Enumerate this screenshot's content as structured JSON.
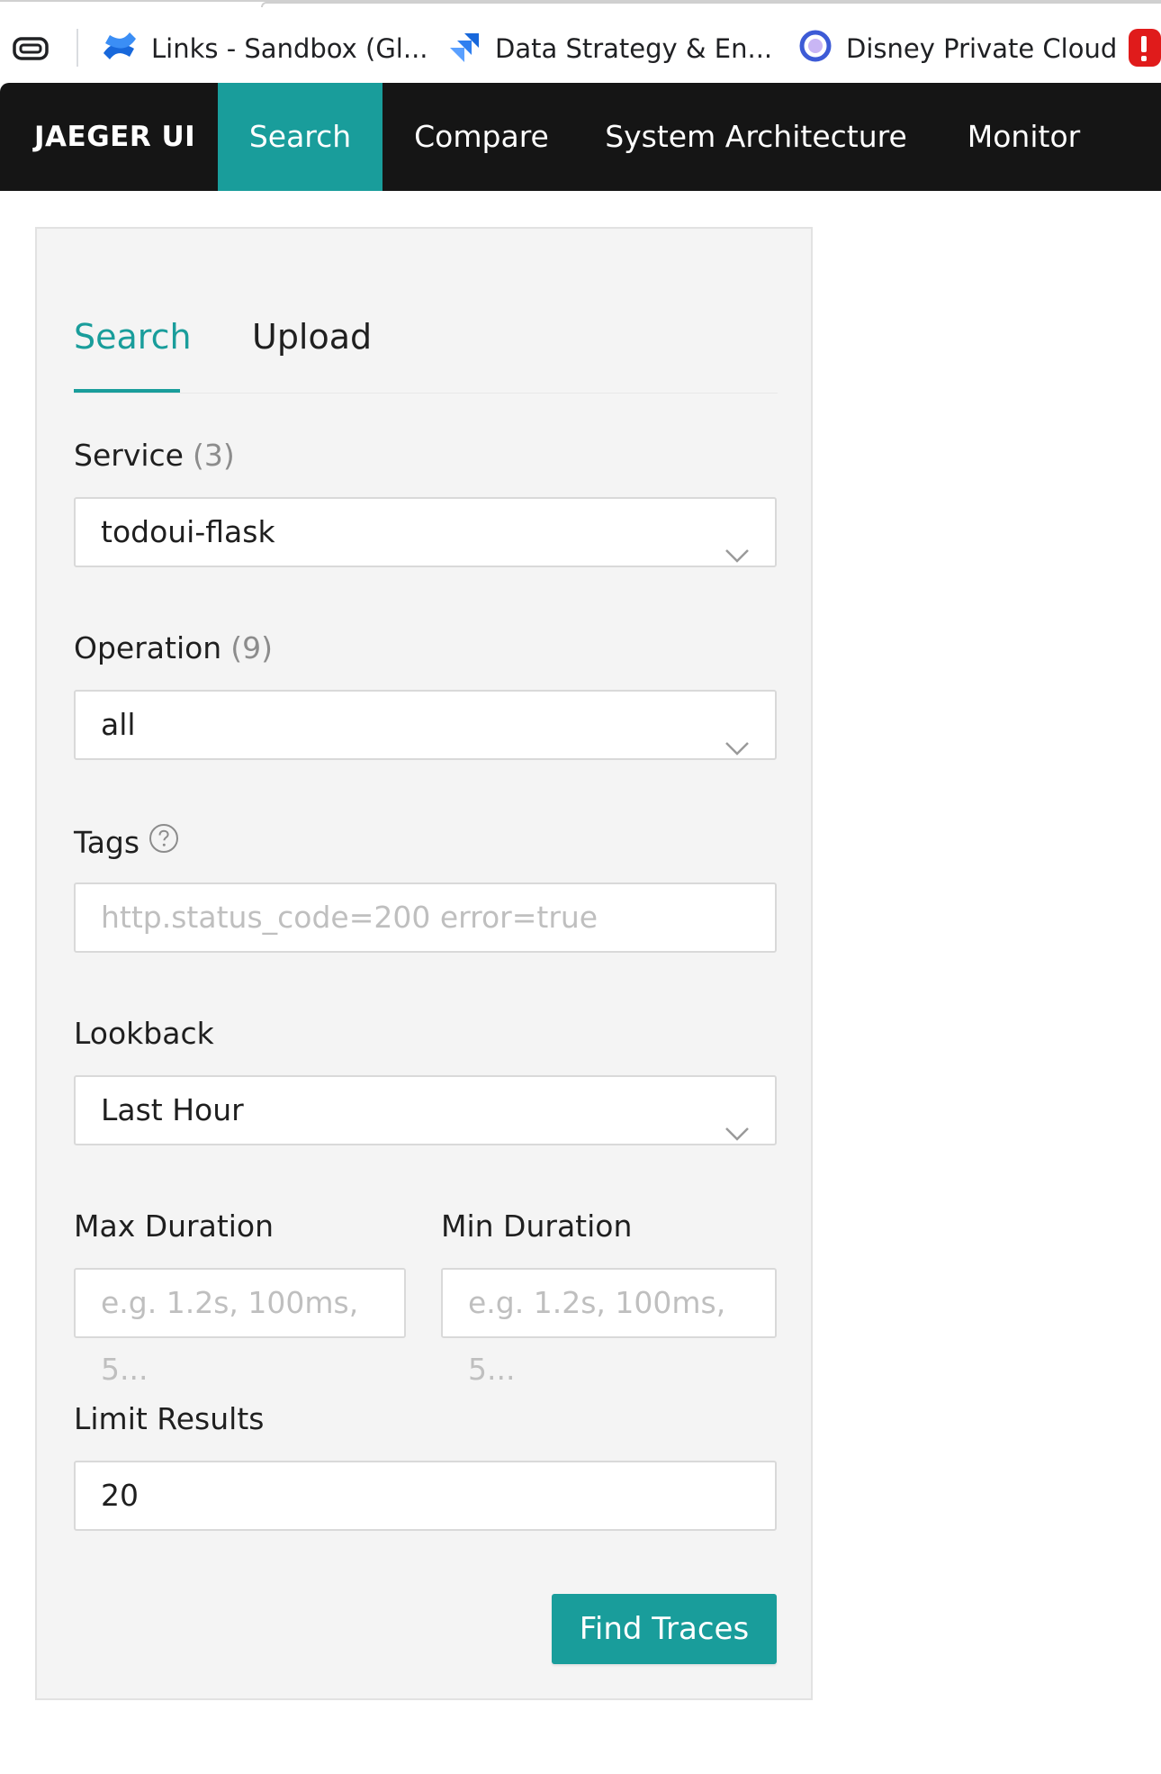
{
  "bookmarks": [
    {
      "label": "Links - Sandbox (Gl...",
      "icon": "confluence-icon"
    },
    {
      "label": "Data Strategy & En...",
      "icon": "jira-icon"
    },
    {
      "label": "Disney Private Cloud",
      "icon": "cloud-ring-icon"
    }
  ],
  "navbar": {
    "brand": "JAEGER UI",
    "items": [
      "Search",
      "Compare",
      "System Architecture",
      "Monitor"
    ],
    "active": "Search",
    "accent_color": "#199d9b",
    "background": "#151515"
  },
  "panel": {
    "tabs": [
      "Search",
      "Upload"
    ],
    "active_tab": "Search",
    "service": {
      "label": "Service",
      "count": "(3)",
      "value": "todoui-flask"
    },
    "operation": {
      "label": "Operation",
      "count": "(9)",
      "value": "all"
    },
    "tags": {
      "label": "Tags",
      "placeholder": "http.status_code=200 error=true"
    },
    "lookback": {
      "label": "Lookback",
      "value": "Last Hour"
    },
    "max_duration": {
      "label": "Max Duration",
      "placeholder": "e.g. 1.2s, 100ms, 5..."
    },
    "min_duration": {
      "label": "Min Duration",
      "placeholder": "e.g. 1.2s, 100ms, 5..."
    },
    "limit": {
      "label": "Limit Results",
      "value": "20"
    },
    "find_button": "Find Traces"
  }
}
